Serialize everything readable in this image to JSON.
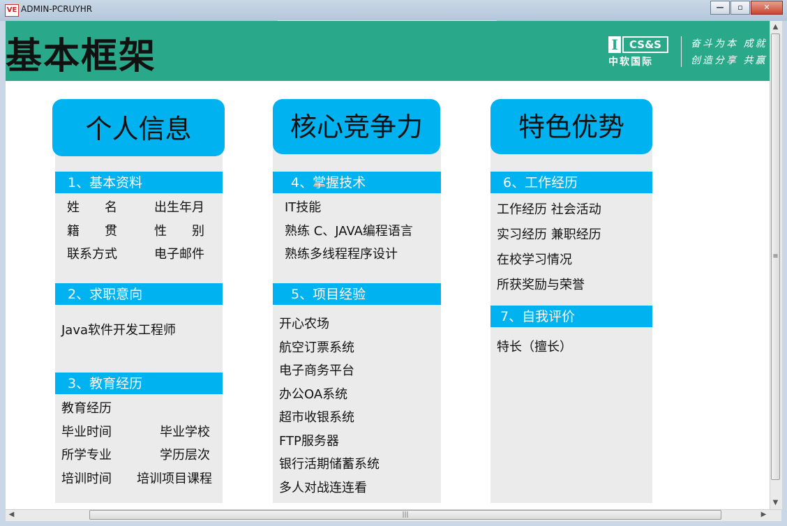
{
  "window": {
    "title": "ADMIN-PCRUYHR",
    "app_icon": "VE",
    "minimize_icon": "—",
    "maximize_icon": "▫",
    "close_icon": "✕"
  },
  "slide": {
    "title": "基本框架",
    "logo": {
      "mark": "I",
      "text": "CS&S",
      "cn": "中软国际"
    },
    "slogan": {
      "line1": "奋斗为本 成就",
      "line2": "创造分享 共赢"
    },
    "columns": [
      {
        "header": "个人信息",
        "sections": [
          {
            "title": "1、基本资料",
            "items": [
              [
                "姓　　名",
                "出生年月"
              ],
              [
                "籍　　贯",
                "性　　别"
              ],
              [
                "联系方式",
                "电子邮件"
              ]
            ]
          },
          {
            "title": "2、求职意向",
            "items": [
              "Java软件开发工程师"
            ]
          },
          {
            "title": "3、教育经历",
            "items": [
              "教育经历",
              [
                "毕业时间",
                "毕业学校"
              ],
              [
                "所学专业",
                "学历层次"
              ],
              [
                "培训时间",
                "培训项目课程"
              ]
            ]
          }
        ]
      },
      {
        "header": "核心竞争力",
        "sections": [
          {
            "title": "4、掌握技术",
            "items": [
              "IT技能",
              "熟练 C、JAVA编程语言",
              "熟练多线程程序设计"
            ]
          },
          {
            "title": "5、项目经验",
            "items": [
              "开心农场",
              "航空订票系统",
              "电子商务平台",
              "办公OA系统",
              "超市收银系统",
              "FTP服务器",
              "银行活期储蓄系统",
              "多人对战连连看"
            ]
          }
        ]
      },
      {
        "header": "特色优势",
        "sections": [
          {
            "title": "6、工作经历",
            "items": [
              "工作经历  社会活动",
              "实习经历  兼职经历",
              "在校学习情况",
              "所获奖励与荣誉"
            ]
          },
          {
            "title": "7、自我评价",
            "items": [
              "特长（擅长）"
            ]
          }
        ]
      }
    ]
  },
  "scrollbars": {
    "up": "▲",
    "down": "▼",
    "left": "◀",
    "right": "▶",
    "grip_v": "≡",
    "grip_h": "|||"
  },
  "colors": {
    "banner": "#2aa98a",
    "accent": "#00b2ef",
    "panel": "#ebebeb"
  }
}
